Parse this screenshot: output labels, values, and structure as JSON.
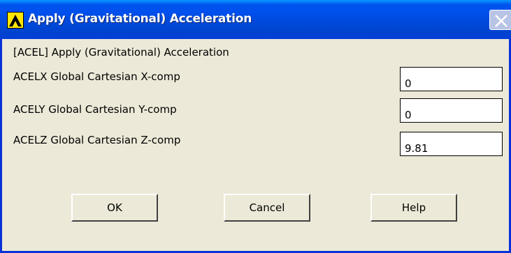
{
  "window": {
    "title": "Apply (Gravitational) Acceleration",
    "icon": "ansys-logo-icon",
    "close_icon": "close-icon"
  },
  "dialog": {
    "header": "[ACEL]  Apply (Gravitational) Acceleration",
    "fields": [
      {
        "label": "ACELX  Global Cartesian X-comp",
        "value": "0"
      },
      {
        "label": "ACELY  Global Cartesian Y-comp",
        "value": "0"
      },
      {
        "label": "ACELZ  Global Cartesian Z-comp",
        "value": "9.81"
      }
    ]
  },
  "buttons": {
    "ok": "OK",
    "cancel": "Cancel",
    "help": "Help"
  },
  "colors": {
    "titlebar": "#0050ee",
    "dialog_bg": "#ece9d8",
    "logo_bg": "#ffe600"
  }
}
